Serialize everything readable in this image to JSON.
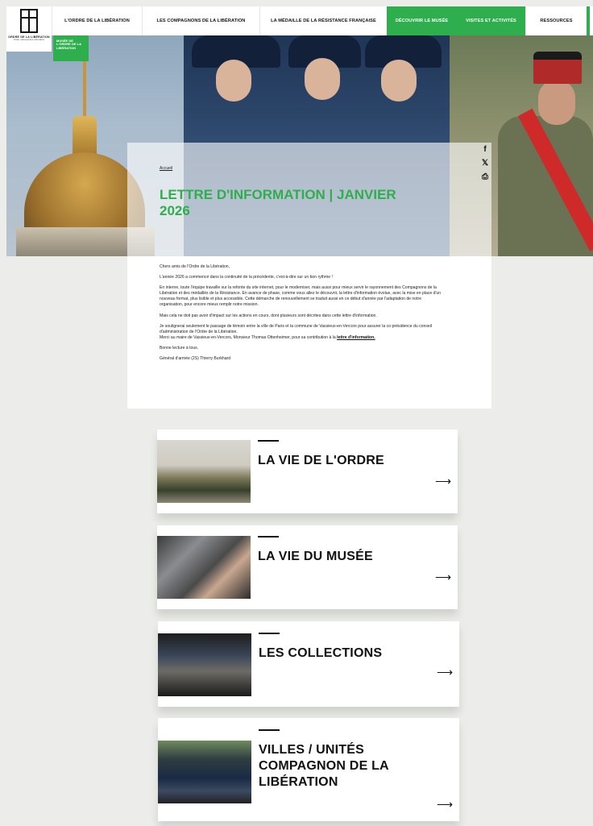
{
  "header": {
    "logo_text": "ORDRE DE LA LIBÉRATION",
    "logo_sub": "Ordre national des Libération",
    "nav": [
      {
        "label": "L'ordre de la Libération",
        "active": false
      },
      {
        "label": "Les compagnons de la Libération",
        "active": false
      },
      {
        "label": "La médaille de la Résistance française",
        "active": false
      },
      {
        "label": "Découvrir le musée",
        "active": true
      },
      {
        "label": "Visites et activités",
        "active": true
      },
      {
        "label": "Ressources",
        "active": false
      }
    ]
  },
  "hero": {
    "musee_tag": "MUSÉE DE L'ORDRE DE LA LIBÉRATION"
  },
  "share": {
    "icons": [
      "facebook-icon",
      "x-icon",
      "print-icon"
    ],
    "facebook_glyph": "f",
    "x_glyph": "𝕏",
    "print_glyph": "⎙"
  },
  "main": {
    "breadcrumb": "Accueil",
    "title": "LETTRE D'INFORMATION | JANVIER 2026",
    "letter": {
      "p1": "Chers amis de l'Ordre de la Libération,",
      "p2": "L'année 2026 a commencé dans la continuité de la précédente, c'est-à-dire sur un bon rythme !",
      "p3": "En interne, toute l'équipe travaille sur la refonte du site internet, pour le moderniser, mais aussi pour mieux servir le rayonnement des Compagnons de la Libération et des médaillés de la Résistance. En avance de phase, comme vous allez le découvrir, la lettre d'information évolue, avec la mise en place d'un nouveau format, plus lisible et plus accessible. Cette démarche de renouvellement se traduit aussi en ce début d'année par l'adaptation de notre organisation, pour encore mieux remplir notre mission.",
      "p4": "Mais cela ne doit pas avoir d'impact sur les actions en cours, dont plusieurs sont décrites dans cette lettre d'information.",
      "p5a": "Je soulignerai seulement le passage de témoin entre la ville de Paris et la commune de Vassieux-en-Vercors pour assurer la co-présidence du conseil d'administration de l'Ordre de la Libération.",
      "p5b": "Merci au maire de Vassieux-en-Vercors, Monsieur Thomas Ottenheimer, pour sa contribution à la ",
      "p5_link": "lettre d'information.",
      "p6": "Bonne lecture à tous.",
      "p7": "Général d'armée (2S) Thierry Burkhard"
    }
  },
  "cards": [
    {
      "title": "LA VIE DE L'ORDRE",
      "arrow": "⟶"
    },
    {
      "title": "LA VIE DU MUSÉE",
      "arrow": "⟶"
    },
    {
      "title": "LES COLLECTIONS",
      "arrow": "⟶"
    },
    {
      "title": "VILLES / UNITÉS COMPAGNON DE LA LIBÉRATION",
      "arrow": "⟶"
    }
  ]
}
